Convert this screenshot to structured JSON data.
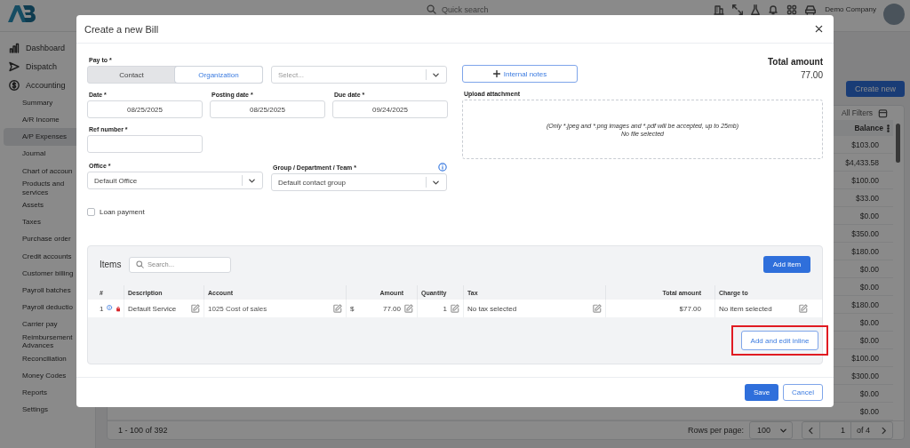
{
  "topbar": {
    "search_placeholder": "Quick search",
    "company": "Demo Company"
  },
  "sidebar": {
    "items": [
      {
        "label": "Dashboard"
      },
      {
        "label": "Dispatch"
      },
      {
        "label": "Accounting",
        "children": [
          {
            "label": "Summary",
            "selected": false
          },
          {
            "label": "A/R Income",
            "selected": false
          },
          {
            "label": "A/P Expenses",
            "selected": true
          },
          {
            "label": "Journal",
            "selected": false
          },
          {
            "label": "Chart of accoun",
            "selected": false
          },
          {
            "label": "Products and services",
            "selected": false
          },
          {
            "label": "Assets",
            "selected": false
          },
          {
            "label": "Taxes",
            "selected": false
          },
          {
            "label": "Purchase order",
            "selected": false
          },
          {
            "label": "Credit accounts",
            "selected": false
          },
          {
            "label": "Customer billing",
            "selected": false
          },
          {
            "label": "Payroll batches",
            "selected": false
          },
          {
            "label": "Payroll deductio",
            "selected": false
          },
          {
            "label": "Carrier pay",
            "selected": false
          },
          {
            "label": "Reimbursement Advances",
            "selected": false
          },
          {
            "label": "Reconciliation",
            "selected": false
          },
          {
            "label": "Money Codes",
            "selected": false
          },
          {
            "label": "Reports",
            "selected": false
          },
          {
            "label": "Settings",
            "selected": false
          }
        ]
      }
    ]
  },
  "main": {
    "create_button": "Create new",
    "filters_button": "All Filters",
    "table": {
      "columns": [
        "Balance"
      ],
      "rows": [
        [
          "$103.00"
        ],
        [
          "$4,433.58"
        ],
        [
          "$100.00"
        ],
        [
          "$33.00"
        ],
        [
          "$0.00"
        ],
        [
          "$350.00"
        ],
        [
          "$180.00"
        ],
        [
          "$0.00"
        ],
        [
          "$0.00"
        ],
        [
          "$180.00"
        ],
        [
          "$0.00"
        ],
        [
          "$0.00"
        ],
        [
          "$100.00"
        ],
        [
          "$300.00"
        ],
        [
          "$0.00"
        ],
        [
          "$0.00"
        ]
      ]
    },
    "pagination": {
      "range": "1 - 100 of 392",
      "rows_per_page_label": "Rows per page:",
      "rows_per_page": "100",
      "page": "1",
      "page_count": "of 4"
    }
  },
  "modal": {
    "title": "Create a new Bill",
    "pay_to": {
      "label": "Pay to *",
      "options": [
        {
          "label": "Contact",
          "selected": false
        },
        {
          "label": "Organization",
          "selected": true
        }
      ],
      "select": {
        "placeholder": "Select..."
      }
    },
    "internal_notes_button": "Internal notes",
    "total": {
      "label": "Total amount",
      "value": "77.00"
    },
    "dates": [
      {
        "label": "Date *",
        "value": "08/25/2025"
      },
      {
        "label": "Posting date *",
        "value": "08/25/2025"
      },
      {
        "label": "Due date *",
        "value": "09/24/2025"
      }
    ],
    "upload": {
      "label": "Upload attachment",
      "hint": "(Only *.jpeg and *.png images and *.pdf will be accepted, up to 25mb)",
      "status": "No file selected"
    },
    "ref_number": {
      "label": "Ref number *"
    },
    "office": {
      "label": "Office *",
      "value": "Default Office"
    },
    "group": {
      "label": "Group / Department / Team *",
      "value": "Default contact group"
    },
    "loan_payment": {
      "label": "Loan payment",
      "checked": false
    },
    "items": {
      "title": "Items",
      "search": {
        "placeholder": "Search..."
      },
      "add_button": "Add item",
      "columns": [
        "#",
        "Description",
        "Account",
        "Amount",
        "Quantity",
        "Tax",
        "Total amount",
        "Charge to"
      ],
      "rows": [
        {
          "number": "1",
          "description": "Default Service",
          "account": "1025 Cost of sales",
          "currency": "$",
          "amount": "77.00",
          "quantity": "1",
          "tax": "No tax selected",
          "total": "$77.00",
          "charge_to": "No item selected"
        }
      ],
      "inline_button": {
        "label": "Add and edit inline",
        "highlighted": true
      }
    },
    "footer": {
      "buttons": [
        {
          "label": "Save",
          "kind": "primary"
        },
        {
          "label": "Cancel",
          "kind": "secondary"
        }
      ]
    }
  }
}
